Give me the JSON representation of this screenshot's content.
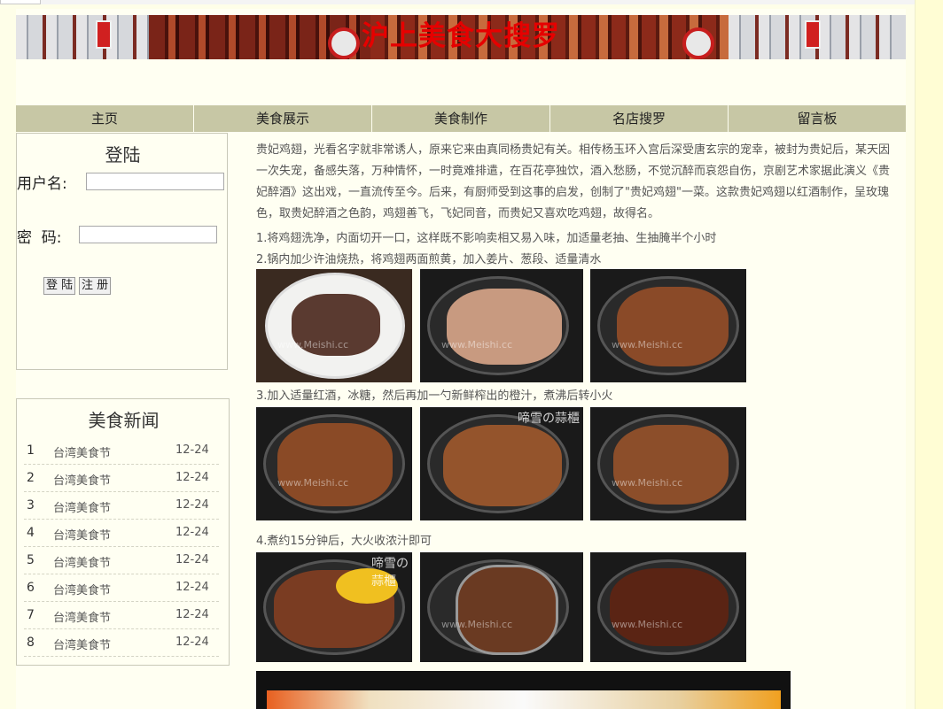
{
  "banner": {
    "title": "沪上美食大搜罗"
  },
  "nav": {
    "items": [
      "主页",
      "美食展示",
      "美食制作",
      "名店搜罗",
      "留言板"
    ]
  },
  "login": {
    "title": "登陆",
    "username_label": "用户名:",
    "password_label": "密  码:",
    "username_value": "",
    "password_value": "",
    "login_button": "登 陆",
    "register_button": "注 册"
  },
  "news": {
    "title": "美食新闻",
    "items": [
      {
        "num": "1",
        "text": "台湾美食节",
        "date": "12-24"
      },
      {
        "num": "2",
        "text": "台湾美食节",
        "date": "12-24"
      },
      {
        "num": "3",
        "text": "台湾美食节",
        "date": "12-24"
      },
      {
        "num": "4",
        "text": "台湾美食节",
        "date": "12-24"
      },
      {
        "num": "5",
        "text": "台湾美食节",
        "date": "12-24"
      },
      {
        "num": "6",
        "text": "台湾美食节",
        "date": "12-24"
      },
      {
        "num": "7",
        "text": "台湾美食节",
        "date": "12-24"
      },
      {
        "num": "8",
        "text": "台湾美食节",
        "date": "12-24"
      }
    ]
  },
  "article": {
    "intro": "贵妃鸡翅，光看名字就非常诱人，原来它来由真同杨贵妃有关。相传杨玉环入宫后深受唐玄宗的宠幸，被封为贵妃后，某天因一次失宠，备感失落，万种情怀，一时竟难排遣，在百花亭独饮，酒入愁肠，不觉沉醉而哀怨自伤，京剧艺术家据此演义《贵妃醉酒》这出戏，一直流传至今。后来，有厨师受到这事的启发，创制了\"贵妃鸡翅\"一菜。这款贵妃鸡翅以红酒制作，呈玫瑰色，取贵妃醉酒之色韵，鸡翅善飞，飞妃同音，而贵妃又喜欢吃鸡翅，故得名。",
    "step1": "1.将鸡翅洗净，内面切开一口，这样既不影响卖相又易入味，加适量老抽、生抽腌半个小时",
    "step2": "2.锅内加少许油烧热，将鸡翅两面煎黄，加入姜片、葱段、适量清水",
    "step3": "3.加入适量红酒，冰糖，然后再加一勺新鲜榨出的橙汁，煮沸后转小火",
    "step4": "4.煮约15分钟后，大火收浓汁即可",
    "watermark": "www.Meishi.cc",
    "watermark2": "啼雪の蒜櫃"
  },
  "colors": {
    "background": "#fefee8",
    "nav": "#c7c7a5",
    "title": "#e60000"
  }
}
